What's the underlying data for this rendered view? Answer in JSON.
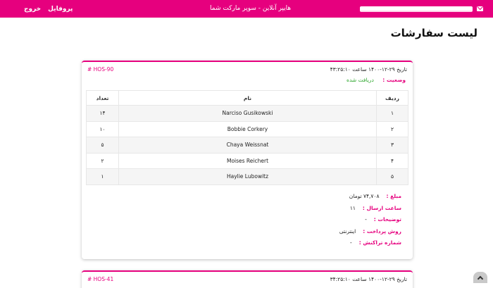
{
  "nav": {
    "logout": "خروج",
    "profile": "پروفایل",
    "title": "هایپر آنلاین - سوپر مارکت شما"
  },
  "page_title": "لیست سفارشات",
  "orders": [
    {
      "id": "# HOS-90",
      "date": "تاریخ ۲۹-۱۲-۱۴۰۰ ساعت ۴۳:۲۵:۱۰",
      "status_label": "وضعیت :",
      "status_value": "دریافت شده",
      "table": {
        "headers": [
          "ردیف",
          "نام",
          "تعداد"
        ],
        "rows": [
          [
            "۱",
            "Narciso Gusikowski",
            "۱۴"
          ],
          [
            "۲",
            "Bobbie Corkery",
            "۱۰"
          ],
          [
            "۳",
            "Chaya Weissnat",
            "۵"
          ],
          [
            "۴",
            "Moises Reichert",
            "۲"
          ],
          [
            "۵",
            "Haylie Lubowitz",
            "۱"
          ]
        ]
      },
      "details": [
        {
          "label": "مبلغ :",
          "value": "۷۴,۷۰۸ تومان"
        },
        {
          "label": "ساعت ارسال :",
          "value": "۱۱"
        },
        {
          "label": "توضیحات :",
          "value": "-"
        },
        {
          "label": "روش پرداخت :",
          "value": "اینترنتی"
        },
        {
          "label": "شماره تراکنش :",
          "value": "-"
        }
      ]
    },
    {
      "id": "# HOS-41",
      "date": "تاریخ ۲۹-۱۲-۱۴۰۰ ساعت ۳۴:۲۵:۱۰"
    }
  ],
  "colors": {
    "accent": "#e6007e",
    "status_ok": "#2aa52a"
  }
}
